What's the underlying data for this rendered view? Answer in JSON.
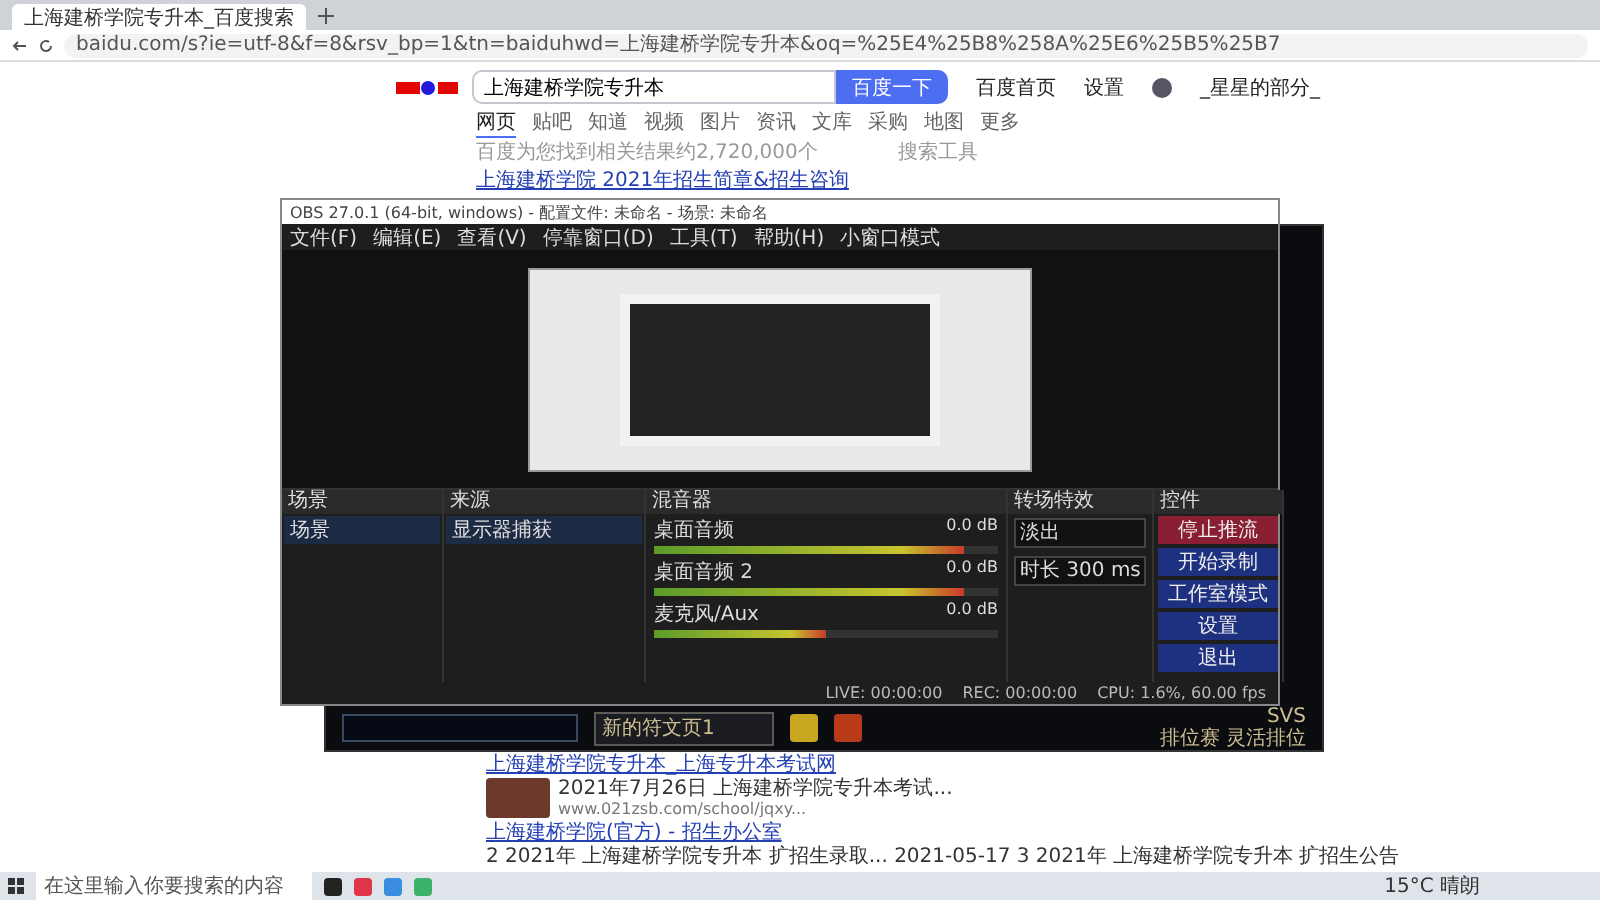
{
  "browser": {
    "tab_title": "上海建桥学院专升本_百度搜索",
    "url": "baidu.com/s?ie=utf-8&f=8&rsv_bp=1&tn=baiduhwd=上海建桥学院专升本&oq=%25E4%25B8%258A%25E6%25B5%25B7"
  },
  "baidu": {
    "query": "上海建桥学院专升本",
    "search_button": "百度一下",
    "header_links": [
      "百度首页",
      "设置"
    ],
    "user": "_星星的部分_",
    "tabs": [
      {
        "label": "网页",
        "selected": true
      },
      {
        "label": "贴吧",
        "selected": false
      },
      {
        "label": "知道",
        "selected": false
      },
      {
        "label": "视频",
        "selected": false
      },
      {
        "label": "图片",
        "selected": false
      },
      {
        "label": "资讯",
        "selected": false
      },
      {
        "label": "文库",
        "selected": false
      },
      {
        "label": "采购",
        "selected": false
      },
      {
        "label": "地图",
        "selected": false
      },
      {
        "label": "更多",
        "selected": false
      }
    ],
    "result_count": "百度为您找到相关结果约2,720,000个",
    "tools": "搜索工具",
    "results": [
      {
        "title": "上海建桥学院 2021年招生简章&招生咨询"
      },
      {
        "title": "上海建桥学院专升本_上海专升本考试网",
        "snippet": "2021年7月26日 上海建桥学院专升本考试...",
        "url": "www.021zsb.com/school/jqxy...",
        "has_image": true
      },
      {
        "title": "上海建桥学院(官方) - 招生办公室",
        "snippet": "2 2021年 上海建桥学院专升本 扩招生录取... 2021-05-17 3 2021年 上海建桥学院专升本 扩招生公告"
      }
    ]
  },
  "obs": {
    "title": "OBS 27.0.1 (64-bit, windows) - 配置文件: 未命名 - 场景: 未命名",
    "menu": [
      "文件(F)",
      "编辑(E)",
      "查看(V)",
      "停靠窗口(D)",
      "工具(T)",
      "帮助(H)",
      "小窗口模式"
    ],
    "docks": [
      {
        "kind": "scenes",
        "title": "场景",
        "items": [
          "场景"
        ]
      },
      {
        "kind": "sources",
        "title": "来源",
        "items": [
          "显示器捕获"
        ]
      },
      {
        "kind": "mixer",
        "title": "混音器",
        "channels": [
          {
            "name": "桌面音频",
            "reading": "0.0 dB",
            "level": 0.9
          },
          {
            "name": "桌面音频 2",
            "reading": "0.0 dB",
            "level": 0.9
          },
          {
            "name": "麦克风/Aux",
            "reading": "0.0 dB",
            "level": 0.5
          }
        ]
      },
      {
        "kind": "transitions",
        "title": "转场特效",
        "transition": "淡出",
        "duration": "时长 300 ms"
      },
      {
        "kind": "controls",
        "title": "控件",
        "buttons": [
          {
            "label": "停止推流",
            "active": true
          },
          {
            "label": "开始录制",
            "active": false
          },
          {
            "label": "工作室模式",
            "active": false
          },
          {
            "label": "设置",
            "active": false
          },
          {
            "label": "退出",
            "active": false
          }
        ]
      }
    ],
    "status": [
      "LIVE: 00:00:00",
      "REC: 00:00:00",
      "CPU: 1.6%, 60.00 fps"
    ]
  },
  "game": {
    "rune_page": "新的符文页1",
    "mode_title": "SVS",
    "mode": "排位赛 灵活排位"
  },
  "taskbar": {
    "search_placeholder": "在这里输入你要搜索的内容",
    "weather": "15°C 晴朗"
  }
}
